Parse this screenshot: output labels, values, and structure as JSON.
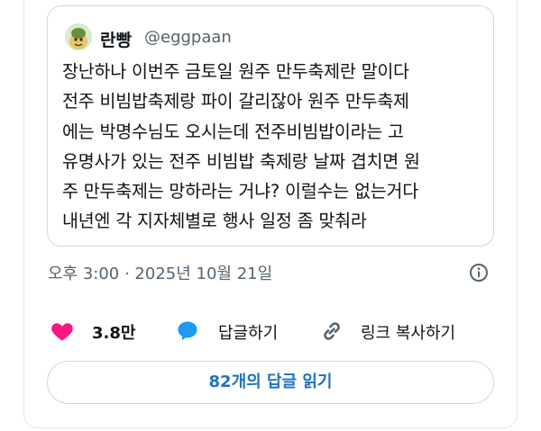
{
  "quoted_tweet": {
    "author_name": "란빵",
    "author_handle": "@eggpaan",
    "text": "장난하나 이번주 금토일 원주 만두축제란 말이다\n전주 비빔밥축제랑 파이 갈리잖아 원주 만두축제\n에는 박명수님도 오시는데 전주비빔밥이라는 고\n유명사가 있는 전주 비빔밥 축제랑 날짜 겹치면 원\n주 만두축제는 망하라는 거냐? 이럴수는 없는거다\n내년엔 각 지자체별로 행사 일정 좀 맞춰라"
  },
  "meta": {
    "timestamp": "오후 3:00 · 2025년 10월 21일"
  },
  "actions": {
    "like_count": "3.8만",
    "reply_label": "답글하기",
    "copy_link_label": "링크 복사하기"
  },
  "read_replies_label": "82개의 답글 읽기",
  "colors": {
    "like": "#f91880",
    "reply": "#1d9bf0",
    "link_text": "#1d72c4"
  }
}
